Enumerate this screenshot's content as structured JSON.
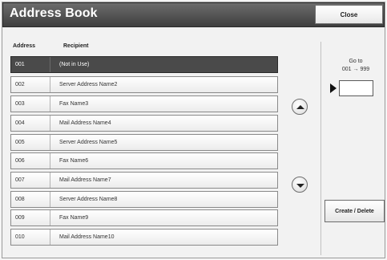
{
  "title": "Address Book",
  "close_label": "Close",
  "columns": {
    "address": "Address",
    "recipient": "Recipient"
  },
  "rows": [
    {
      "address": "001",
      "name": "(Not in Use)",
      "selected": true
    },
    {
      "address": "002",
      "name": "Server Address Name2"
    },
    {
      "address": "003",
      "name": "Fax Name3"
    },
    {
      "address": "004",
      "name": "Mail Address Name4"
    },
    {
      "address": "005",
      "name": "Server Address Name5"
    },
    {
      "address": "006",
      "name": "Fax Name6"
    },
    {
      "address": "007",
      "name": "Mail Address Name7"
    },
    {
      "address": "008",
      "name": "Server Address Name8"
    },
    {
      "address": "009",
      "name": "Fax Name9"
    },
    {
      "address": "010",
      "name": "Mail Address Name10"
    }
  ],
  "goto": {
    "label_line1": "Go to",
    "label_line2": "001 → 999",
    "value": ""
  },
  "create_delete_label": "Create / Delete",
  "icons": {
    "scroll_up": "scroll-up-icon",
    "scroll_down": "scroll-down-icon",
    "pointer": "triangle-pointer-icon"
  }
}
